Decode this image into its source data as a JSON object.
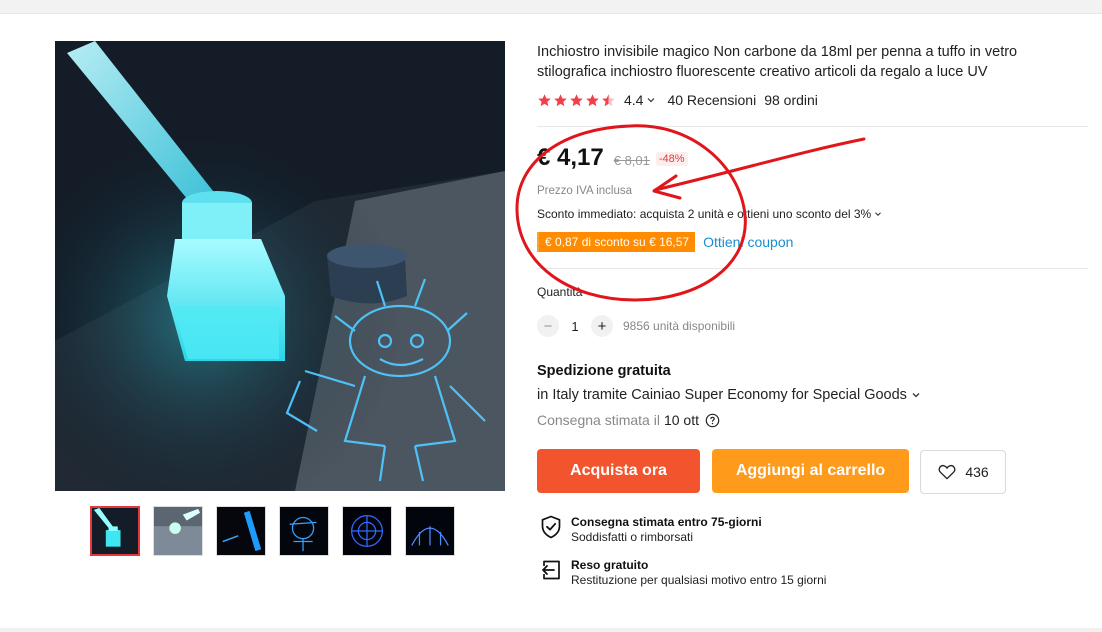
{
  "product": {
    "title": "Inchiostro invisibile magico Non carbone da 18ml per penna a tuffo in vetro stilografica inchiostro fluorescente creativo articoli da regalo a luce UV",
    "rating": "4.4",
    "rating_stars": 4.5,
    "reviews": "40 Recensioni",
    "orders": "98 ordini"
  },
  "price": {
    "current": "€ 4,17",
    "original": "€ 8,01",
    "discount": "-48%",
    "vat_note": "Prezzo IVA inclusa",
    "instant_discount": "Sconto immediato: acquista 2 unità e ottieni uno sconto del 3%",
    "coupon_tag": "€ 0,87 di sconto su € 16,57",
    "coupon_link": "Ottieni coupon"
  },
  "quantity": {
    "label": "Quantità",
    "value": "1",
    "available": "9856 unità disponibili",
    "minus": "−",
    "plus": "+"
  },
  "shipping": {
    "title": "Spedizione gratuita",
    "method": "in Italy tramite Cainiao Super Economy for Special Goods",
    "delivery_label": "Consegna stimata il",
    "delivery_date": "10 ott"
  },
  "actions": {
    "buy_now": "Acquista ora",
    "add_to_cart": "Aggiungi al carrello",
    "wishlist_count": "436"
  },
  "guarantees": [
    {
      "title": "Consegna stimata entro 75-giorni",
      "subtitle": "Soddisfatti o rimborsati",
      "icon": "shield-check-icon"
    },
    {
      "title": "Reso gratuito",
      "subtitle": "Restituzione per qualsiasi motivo entro 15 giorni",
      "icon": "return-icon"
    }
  ],
  "gallery": {
    "thumbnail_count": 6,
    "selected_index": 0
  },
  "colors": {
    "buy_button": "#f2542d",
    "cart_button": "#ff9a1b",
    "star": "#f0414b",
    "coupon_tag": "#ff8c00",
    "link": "#1a8fd0",
    "annotation": "#e0161b"
  }
}
